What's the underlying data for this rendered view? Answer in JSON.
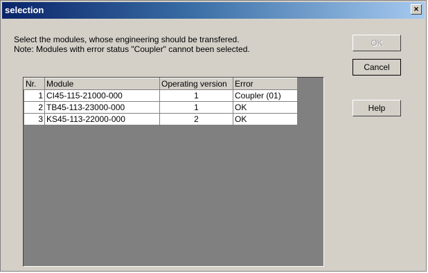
{
  "window": {
    "title": "selection",
    "close_label": "×"
  },
  "instructions": {
    "line1": "Select the modules, whose engineering should be transfered.",
    "line2": "Note: Modules with error status \"Coupler\" cannot been selected."
  },
  "buttons": {
    "ok": "OK",
    "cancel": "Cancel",
    "help": "Help"
  },
  "table": {
    "headers": [
      "Nr.",
      "Module",
      "Operating version",
      "Error"
    ],
    "rows": [
      {
        "nr": "1",
        "module": "CI45-115-21000-000",
        "version": "1",
        "error": "Coupler (01)"
      },
      {
        "nr": "2",
        "module": "TB45-113-23000-000",
        "version": "1",
        "error": "OK"
      },
      {
        "nr": "3",
        "module": "KS45-113-22000-000",
        "version": "2",
        "error": "OK"
      }
    ]
  }
}
